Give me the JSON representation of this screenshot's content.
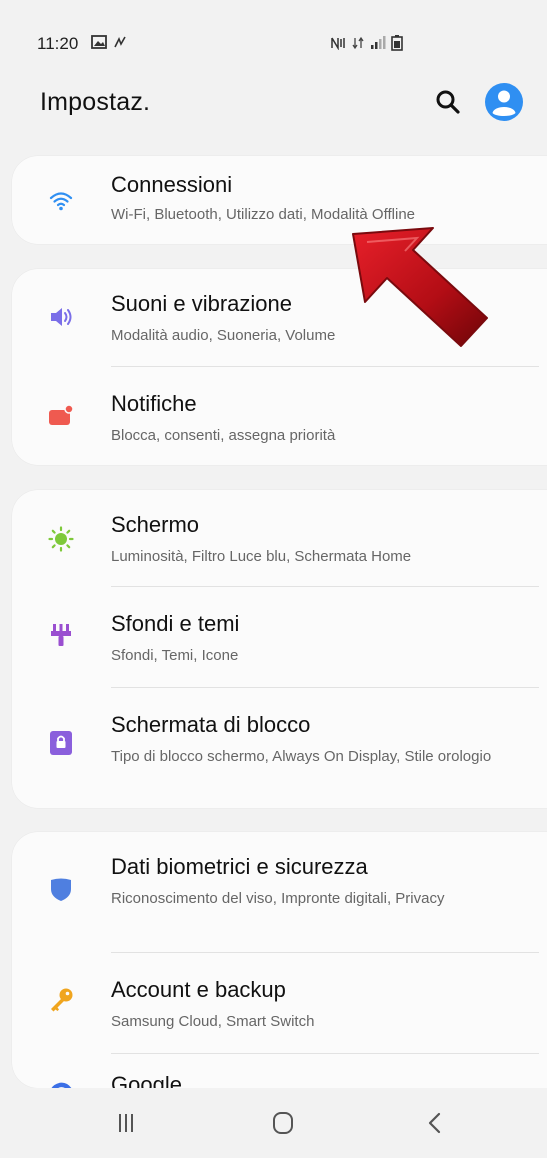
{
  "status_bar": {
    "time": "11:20"
  },
  "header": {
    "title": "Impostaz."
  },
  "cards": [
    {
      "items": [
        {
          "title": "Connessioni",
          "subtitle": "Wi-Fi, Bluetooth, Utilizzo dati, Modalità Offline",
          "icon": "wifi-icon",
          "color": "#2f8ff2"
        }
      ]
    },
    {
      "items": [
        {
          "title": "Suoni e vibrazione",
          "subtitle": "Modalità audio, Suoneria, Volume",
          "icon": "speaker-icon",
          "color": "#7a6ee8"
        },
        {
          "title": "Notifiche",
          "subtitle": "Blocca, consenti, assegna priorità",
          "icon": "notification-icon",
          "color": "#ef5a50"
        }
      ]
    },
    {
      "items": [
        {
          "title": "Schermo",
          "subtitle": "Luminosità, Filtro Luce blu, Schermata Home",
          "icon": "brightness-icon",
          "color": "#7ec93a"
        },
        {
          "title": "Sfondi e temi",
          "subtitle": "Sfondi, Temi, Icone",
          "icon": "brush-icon",
          "color": "#9a4fd0"
        },
        {
          "title": "Schermata di blocco",
          "subtitle": "Tipo di blocco schermo, Always On Display, Stile orologio",
          "icon": "lock-screen-icon",
          "color": "#8a5fdc"
        }
      ]
    },
    {
      "items": [
        {
          "title": "Dati biometrici e sicurezza",
          "subtitle": "Riconoscimento del viso, Impronte digitali, Privacy",
          "icon": "shield-icon",
          "color": "#4f7fe0"
        },
        {
          "title": "Account e backup",
          "subtitle": "Samsung Cloud, Smart Switch",
          "icon": "key-icon",
          "color": "#f0a51e"
        },
        {
          "title": "Google",
          "subtitle": "",
          "icon": "google-icon",
          "color": "#3b6fe6"
        }
      ]
    }
  ],
  "colors": {
    "background": "#f2f2f2",
    "card": "#fbfbfb",
    "accent": "#2f8ff2",
    "arrow": "#c8101a"
  }
}
